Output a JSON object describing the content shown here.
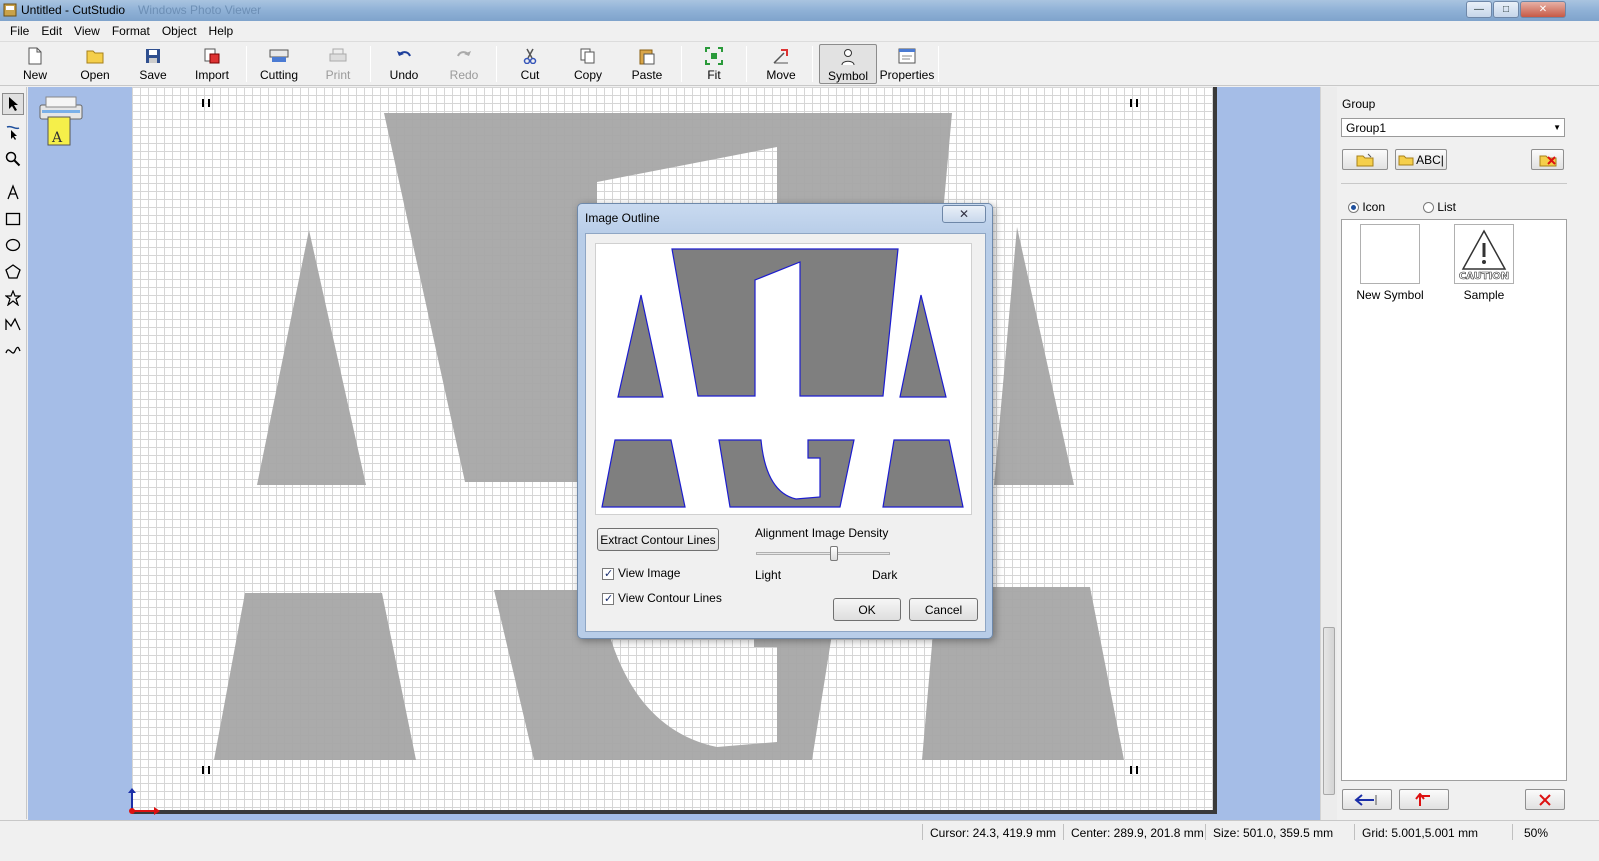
{
  "window": {
    "title": "Untitled - CutStudio",
    "ghost_title": "Windows Photo Viewer",
    "controls": {
      "minimize": "—",
      "maximize": "□",
      "close": "✕"
    }
  },
  "menu": [
    "File",
    "Edit",
    "View",
    "Format",
    "Object",
    "Help"
  ],
  "toolbar": {
    "new": "New",
    "open": "Open",
    "save": "Save",
    "import": "Import",
    "cutting": "Cutting",
    "print": "Print",
    "undo": "Undo",
    "redo": "Redo",
    "cut": "Cut",
    "copy": "Copy",
    "paste": "Paste",
    "fit": "Fit",
    "move": "Move",
    "symbol": "Symbol",
    "properties": "Properties"
  },
  "left_tools": [
    "select-arrow-icon",
    "node-edit-icon",
    "zoom-icon",
    "text-icon",
    "rectangle-icon",
    "ellipse-icon",
    "polygon-icon",
    "star-icon",
    "polyline-icon",
    "curve-icon"
  ],
  "dialog": {
    "title": "Image Outline",
    "close": "✕",
    "extract_button": "Extract Contour Lines",
    "density_label": "Alignment Image Density",
    "density_min": "Light",
    "density_max": "Dark",
    "density_value": 0.55,
    "view_image": {
      "label": "View Image",
      "checked": true
    },
    "view_contour": {
      "label": "View Contour Lines",
      "checked": true
    },
    "ok": "OK",
    "cancel": "Cancel"
  },
  "right_panel": {
    "group_label": "Group",
    "group_value": "Group1",
    "abc_button": "ABC|",
    "view_icon": "Icon",
    "view_list": "List",
    "symbols": [
      {
        "label": "New Symbol"
      },
      {
        "label": "Sample",
        "badge": "CAUTION"
      }
    ]
  },
  "status": {
    "cursor": "Cursor: 24.3, 419.9 mm",
    "center": "Center: 289.9, 201.8 mm",
    "size": "Size: 501.0, 359.5 mm",
    "grid": "Grid: 5.001,5.001 mm",
    "zoom": "50%"
  },
  "colors": {
    "workspace_bg": "#a5bde7",
    "shape_fill": "#a6a6a6",
    "preview_fill": "#7f7f7f",
    "contour": "#1c1ccf",
    "dialog_frame": "#b8cde8"
  }
}
